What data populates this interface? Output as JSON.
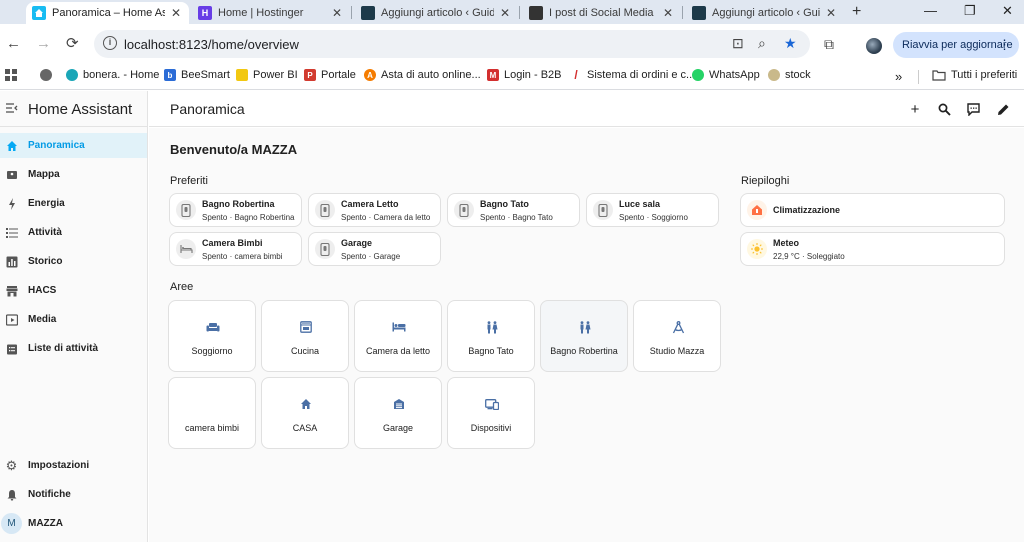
{
  "browser": {
    "tabs": [
      {
        "title": "Panoramica – Home Assis",
        "favicon": "home-assistant-icon"
      },
      {
        "title": "Home | Hostinger",
        "favicon": "hostinger-icon"
      },
      {
        "title": "Aggiungi articolo ‹ Guida",
        "favicon": "site-icon"
      },
      {
        "title": "I post di Social Media ‹ T",
        "favicon": "site-icon"
      },
      {
        "title": "Aggiungi articolo ‹ Guida",
        "favicon": "site-icon"
      }
    ],
    "url": "localhost:8123/home/overview",
    "update_button": "Riavvia per aggiornare",
    "bookmarks": [
      {
        "label": "bonera. - Home"
      },
      {
        "label": "BeeSmart"
      },
      {
        "label": "Power BI"
      },
      {
        "label": "Portale"
      },
      {
        "label": "Asta di auto online..."
      },
      {
        "label": "Login - B2B"
      },
      {
        "label": "Sistema di ordini e c..."
      },
      {
        "label": "WhatsApp"
      },
      {
        "label": "stock"
      }
    ],
    "bookmarks_more": "»",
    "all_bookmarks": "Tutti i preferiti"
  },
  "ha": {
    "app_title": "Home Assistant",
    "page_title": "Panoramica",
    "accent": "#03a9f4",
    "nav": [
      {
        "label": "Panoramica",
        "icon": "home-icon",
        "active": true
      },
      {
        "label": "Mappa",
        "icon": "map-icon"
      },
      {
        "label": "Energia",
        "icon": "lightning-icon"
      },
      {
        "label": "Attività",
        "icon": "list-icon"
      },
      {
        "label": "Storico",
        "icon": "chart-icon"
      },
      {
        "label": "HACS",
        "icon": "store-icon"
      },
      {
        "label": "Media",
        "icon": "media-icon"
      },
      {
        "label": "Liste di attività",
        "icon": "clipboard-icon"
      }
    ],
    "bottom_nav": [
      {
        "label": "Impostazioni",
        "icon": "gear-icon"
      },
      {
        "label": "Notifiche",
        "icon": "bell-icon"
      }
    ],
    "user": {
      "initial": "M",
      "name": "MAZZA"
    },
    "welcome": "Benvenuto/a MAZZA",
    "favorites_title": "Preferiti",
    "favorites": [
      {
        "name": "Bagno Robertina",
        "state": "Spento · Bagno Robertina",
        "icon": "switch-icon"
      },
      {
        "name": "Camera Letto",
        "state": "Spento · Camera da letto",
        "icon": "switch-icon"
      },
      {
        "name": "Bagno Tato",
        "state": "Spento · Bagno Tato",
        "icon": "switch-icon"
      },
      {
        "name": "Luce sala",
        "state": "Spento · Soggiorno",
        "icon": "switch-icon"
      },
      {
        "name": "Camera Bimbi",
        "state": "Spento · camera bimbi",
        "icon": "bed-icon"
      },
      {
        "name": "Garage",
        "state": "Spento · Garage",
        "icon": "switch-icon"
      }
    ],
    "summaries_title": "Riepiloghi",
    "summaries": [
      {
        "name": "Climatizzazione",
        "state": "",
        "icon": "thermostat-icon"
      },
      {
        "name": "Meteo",
        "state": "22,9 °C · Soleggiato",
        "icon": "sun-icon"
      }
    ],
    "areas_title": "Aree",
    "areas": [
      {
        "name": "Soggiorno",
        "icon": "sofa-icon"
      },
      {
        "name": "Cucina",
        "icon": "stove-icon"
      },
      {
        "name": "Camera da letto",
        "icon": "bed-icon"
      },
      {
        "name": "Bagno Tato",
        "icon": "toilet-icon"
      },
      {
        "name": "Bagno Robertina",
        "icon": "toilet-icon"
      },
      {
        "name": "Studio Mazza",
        "icon": "compass-icon"
      },
      {
        "name": "camera bimbi",
        "icon": "none"
      },
      {
        "name": "CASA",
        "icon": "house-icon"
      },
      {
        "name": "Garage",
        "icon": "garage-icon"
      },
      {
        "name": "Dispositivi",
        "icon": "devices-icon"
      }
    ]
  }
}
